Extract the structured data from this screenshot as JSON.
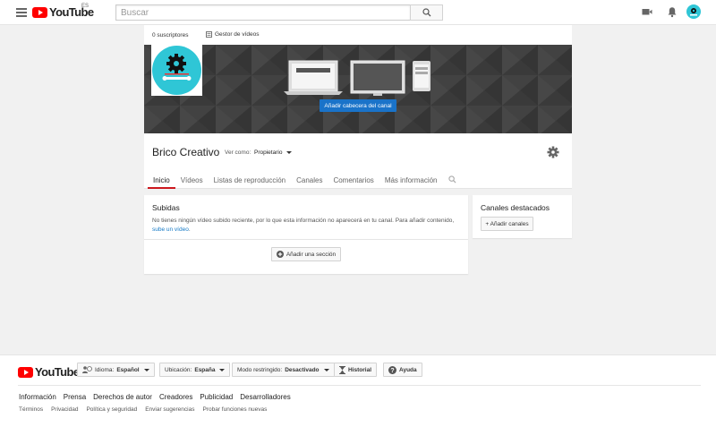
{
  "header": {
    "logo_text": "YouTube",
    "region": "ES",
    "search_placeholder": "Buscar",
    "icons": [
      "menu-icon",
      "search-icon",
      "upload-video-icon",
      "notifications-bell-icon",
      "account-avatar-icon"
    ]
  },
  "channel": {
    "subscribers": "0 suscriptores",
    "video_manager": "Gestor de vídeos",
    "add_banner": "Añadir cabecera del canal",
    "name": "Brico Creativo",
    "view_as_label": "Ver como:",
    "view_as_value": "Propietario"
  },
  "tabs": [
    {
      "label": "Inicio",
      "active": true
    },
    {
      "label": "Vídeos"
    },
    {
      "label": "Listas de reproducción"
    },
    {
      "label": "Canales"
    },
    {
      "label": "Comentarios"
    },
    {
      "label": "Más información"
    }
  ],
  "uploads": {
    "title": "Subidas",
    "text": "No tienes ningún vídeo subido reciente, por lo que esta información no aparecerá en tu canal. Para añadir contenido,",
    "link": "sube un vídeo",
    "text_end": ".",
    "add_section": "Añadir una sección"
  },
  "featured": {
    "title": "Canales destacados",
    "add_button": "+ Añadir canales"
  },
  "footer": {
    "logo_text": "YouTube",
    "language_label": "Idioma:",
    "language_value": "Español",
    "location_label": "Ubicación:",
    "location_value": "España",
    "restricted_label": "Modo restringido:",
    "restricted_value": "Desactivado",
    "history": "Historial",
    "help": "Ayuda",
    "links_primary": [
      "Información",
      "Prensa",
      "Derechos de autor",
      "Creadores",
      "Publicidad",
      "Desarrolladores"
    ],
    "links_secondary": [
      "Términos",
      "Privacidad",
      "Política y seguridad",
      "Enviar sugerencias",
      "Probar funciones nuevas"
    ]
  },
  "colors": {
    "brand_red": "#ff0000",
    "accent_blue": "#1a73c9",
    "avatar_cyan": "#2fc6d6",
    "tab_active": "#cc181e"
  }
}
